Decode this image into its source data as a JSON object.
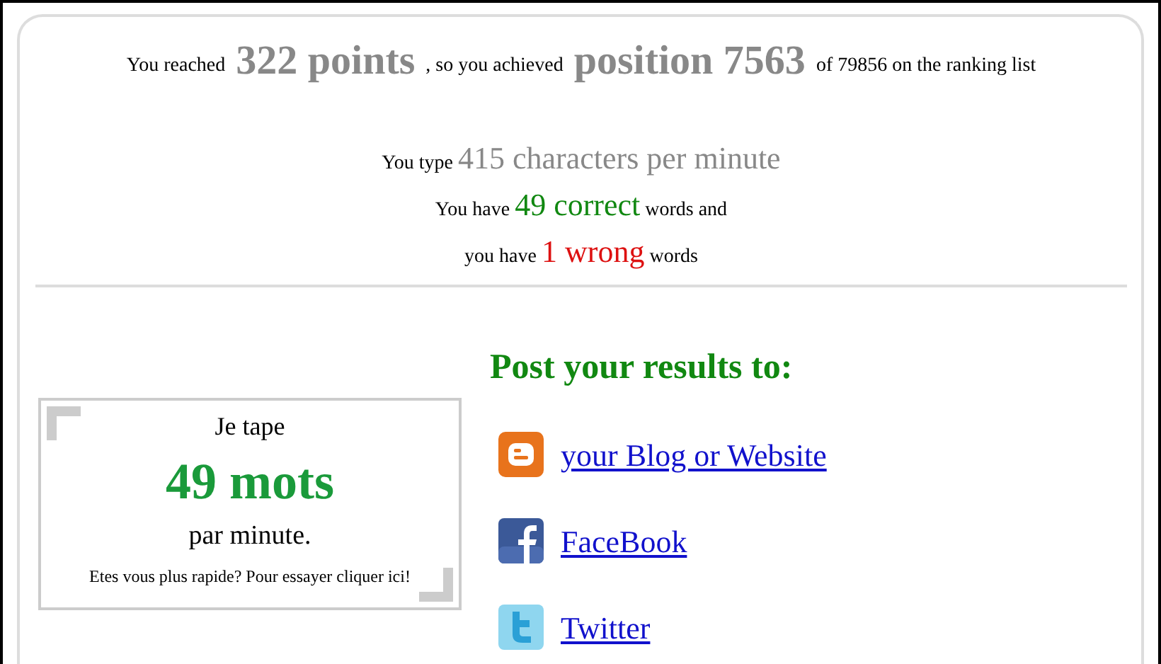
{
  "summary": [
    {
      "text": "You reached",
      "emphasis": false
    },
    {
      "text": "322 points",
      "emphasis": true,
      "color": "#888888"
    },
    {
      "text": ", so you achieved",
      "emphasis": false
    },
    {
      "text": "position 7563",
      "emphasis": true,
      "color": "#888888"
    },
    {
      "text": "of 79856 on the ranking list",
      "emphasis": false
    }
  ],
  "stats": [
    [
      {
        "text": "You type",
        "emphasis": false
      },
      {
        "text": "415 characters per minute",
        "emphasis": true,
        "color": "#888888"
      }
    ],
    [
      {
        "text": "You have",
        "emphasis": false
      },
      {
        "text": "49 correct",
        "emphasis": true,
        "color": "#118811"
      },
      {
        "text": "words and",
        "emphasis": false
      }
    ],
    [
      {
        "text": "you have",
        "emphasis": false
      },
      {
        "text": "1 wrong",
        "emphasis": true,
        "color": "#dd1111"
      },
      {
        "text": "words",
        "emphasis": false
      }
    ]
  ],
  "badge": {
    "intro": "Je tape",
    "count": "49 mots",
    "unit": "par minute.",
    "cta": "Etes vous plus rapide? Pour essayer cliquer ici!"
  },
  "share": {
    "heading": "Post your results to:",
    "links": [
      {
        "kind": "blogger",
        "label": "your Blog or Website"
      },
      {
        "kind": "facebook",
        "label": "FaceBook"
      },
      {
        "kind": "twitter",
        "label": "Twitter"
      }
    ]
  }
}
